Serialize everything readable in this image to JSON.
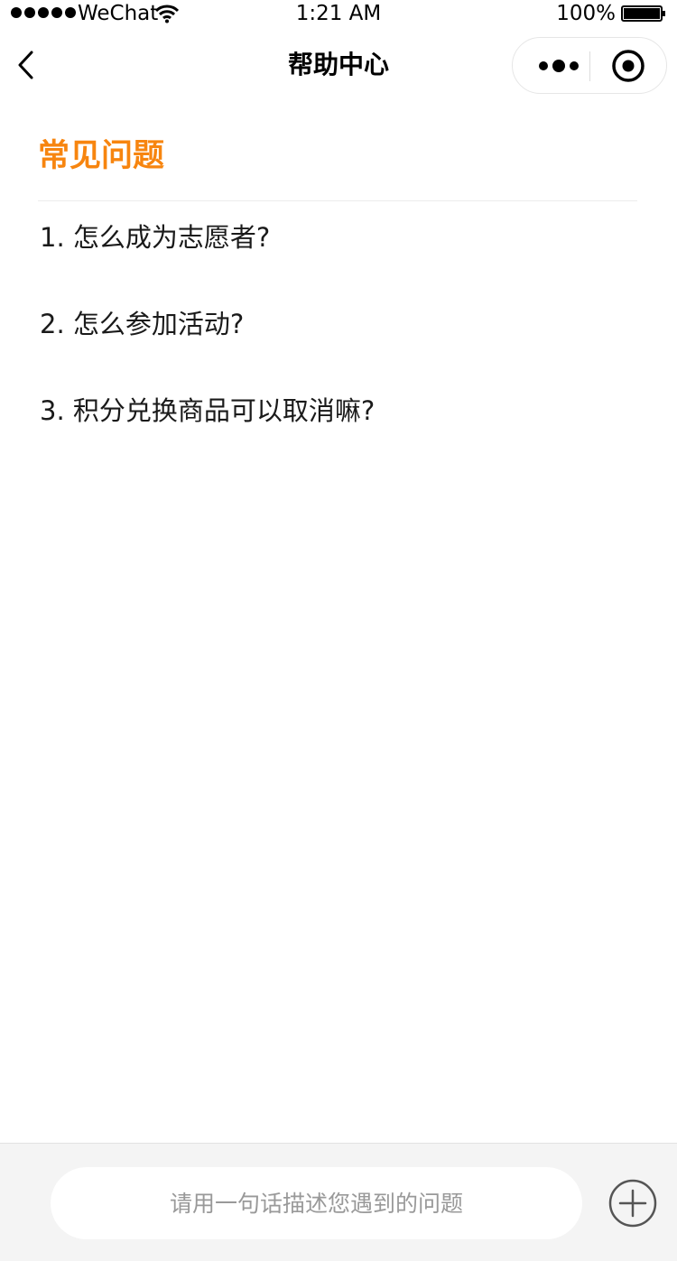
{
  "status_bar": {
    "carrier": "WeChat",
    "time": "1:21 AM",
    "battery_percent": "100%",
    "icons": [
      "signal-icon",
      "wifi-icon",
      "battery-icon"
    ]
  },
  "nav": {
    "title": "帮助中心",
    "icons": [
      "back-icon",
      "more-icon",
      "target-icon"
    ]
  },
  "main": {
    "section_title": "常见问题",
    "faq_items": [
      "1. 怎么成为志愿者?",
      "2. 怎么参加活动?",
      "3. 积分兑换商品可以取消嘛?"
    ]
  },
  "bottom_bar": {
    "placeholder": "请用一句话描述您遇到的问题",
    "icons": [
      "add-circle-icon"
    ]
  },
  "colors": {
    "accent": "#f7850f",
    "bottom_bar_bg": "#f4f4f4",
    "text": "#1a1a1a"
  }
}
